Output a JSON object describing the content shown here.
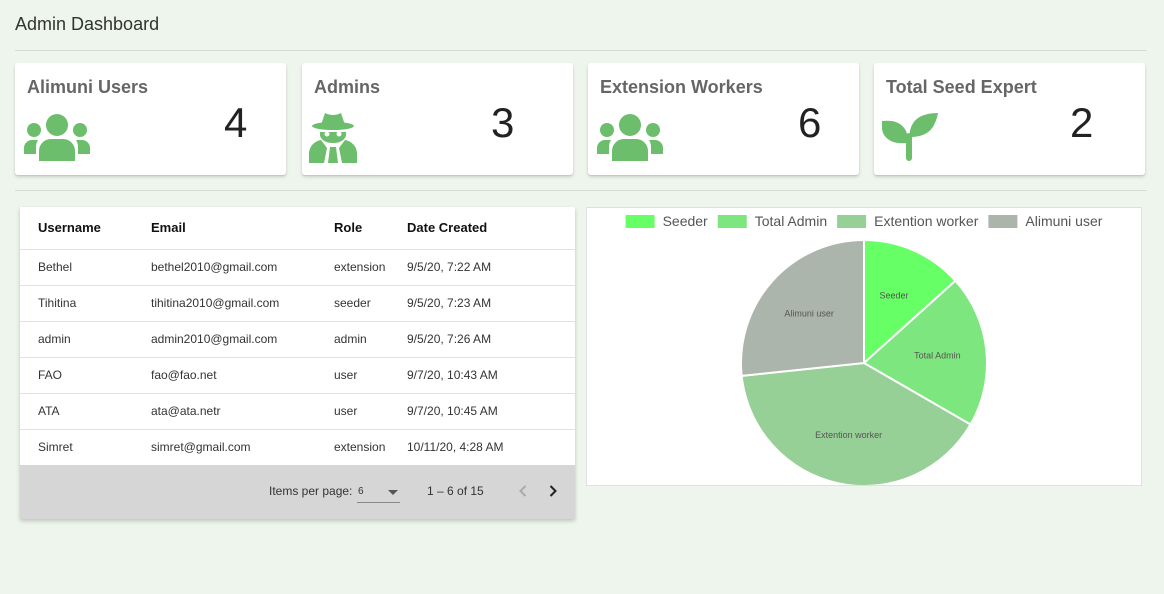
{
  "page": {
    "title": "Admin Dashboard"
  },
  "stats": [
    {
      "title": "Alimuni Users",
      "value": "4",
      "icon": "users-icon"
    },
    {
      "title": "Admins",
      "value": "3",
      "icon": "spy-icon"
    },
    {
      "title": "Extension Workers",
      "value": "6",
      "icon": "users-icon"
    },
    {
      "title": "Total Seed Expert",
      "value": "2",
      "icon": "seedling-icon"
    }
  ],
  "colors": {
    "accent": "#6cbd6c",
    "background": "#eef5ec"
  },
  "table": {
    "headers": [
      "Username",
      "Email",
      "Role",
      "Date Created"
    ],
    "rows": [
      [
        "Bethel",
        "bethel2010@gmail.com",
        "extension",
        "9/5/20, 7:22 AM"
      ],
      [
        "Tihitina",
        "tihitina2010@gmail.com",
        "seeder",
        "9/5/20, 7:23 AM"
      ],
      [
        "admin",
        "admin2010@gmail.com",
        "admin",
        "9/5/20, 7:26 AM"
      ],
      [
        "FAO",
        "fao@fao.net",
        "user",
        "9/7/20, 10:43 AM"
      ],
      [
        "ATA",
        "ata@ata.netr",
        "user",
        "9/7/20, 10:45 AM"
      ],
      [
        "Simret",
        "simret@gmail.com",
        "extension",
        "10/11/20, 4:28 AM"
      ]
    ],
    "paginator": {
      "label": "Items per page:",
      "page_size": "6",
      "range": "1 – 6 of 15"
    }
  },
  "chart_data": {
    "type": "pie",
    "title": "",
    "categories": [
      "Seeder",
      "Total Admin",
      "Extention worker",
      "Alimuni user"
    ],
    "values": [
      2,
      3,
      6,
      4
    ],
    "colors": [
      "#66ff66",
      "#7ee67e",
      "#97d097",
      "#abb5ab"
    ],
    "legend": "top"
  }
}
